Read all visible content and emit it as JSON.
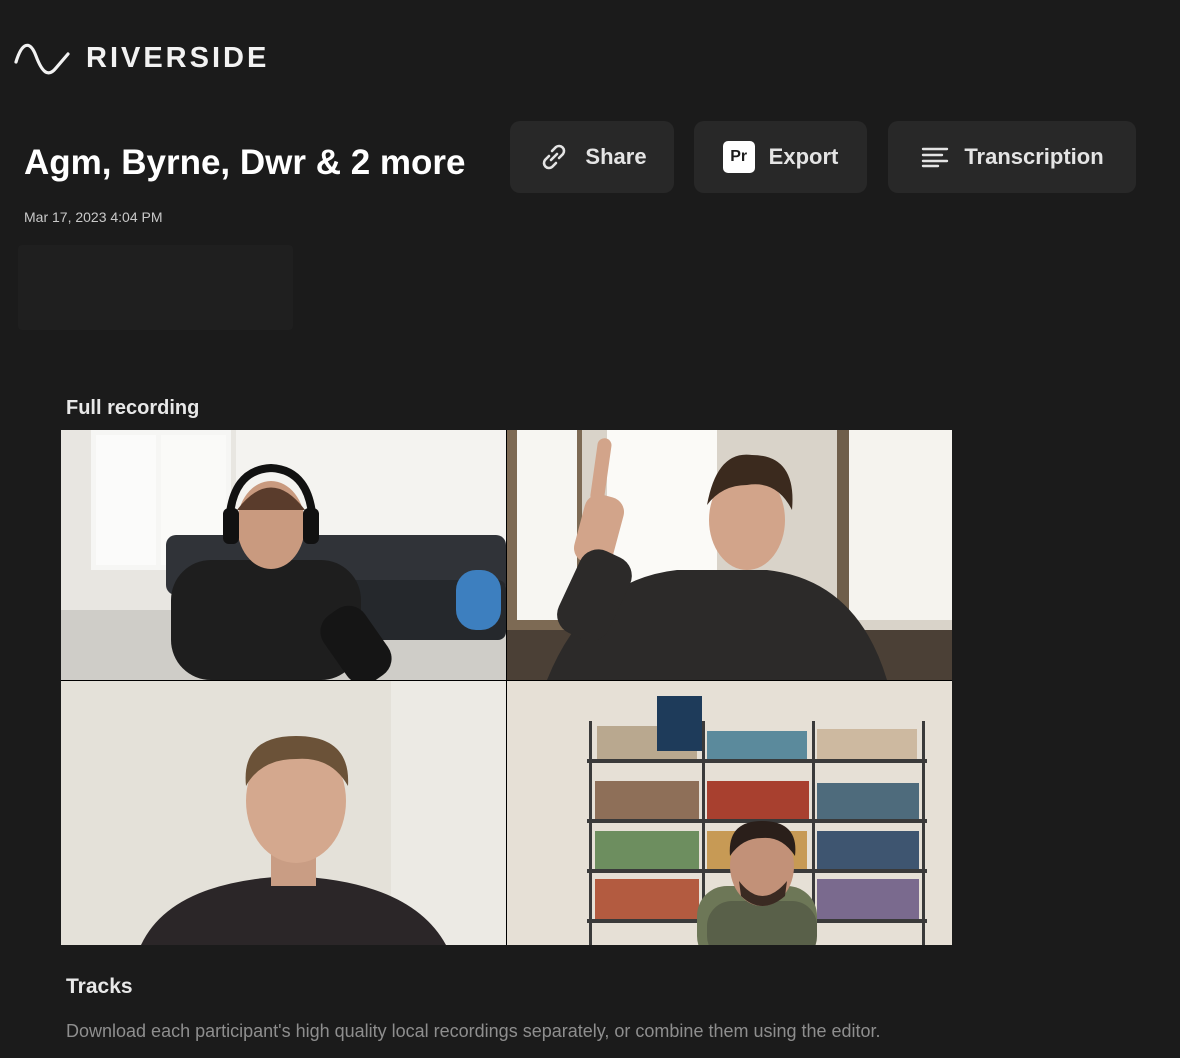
{
  "brand": {
    "name": "RIVERSIDE",
    "logo_icon": "wave-icon"
  },
  "recording": {
    "title": "Agm, Byrne, Dwr & 2 more",
    "date": "Mar 17, 2023 4:04 PM"
  },
  "actions": {
    "share": {
      "label": "Share",
      "icon": "link-icon"
    },
    "export": {
      "label": "Export",
      "icon": "premiere-pro-icon",
      "icon_text": "Pr"
    },
    "transcription": {
      "label": "Transcription",
      "icon": "text-lines-icon"
    }
  },
  "full_recording": {
    "label": "Full recording",
    "tiles": [
      {
        "description": "participant-1-video"
      },
      {
        "description": "participant-2-video"
      },
      {
        "description": "participant-3-video"
      },
      {
        "description": "participant-4-video"
      }
    ]
  },
  "tracks": {
    "label": "Tracks",
    "description": "Download each participant's high quality local recordings separately, or combine them using the editor."
  },
  "colors": {
    "background": "#1b1b1b",
    "button_bg": "#282828",
    "text_primary": "#ffffff",
    "text_muted": "#8e8e8e"
  }
}
